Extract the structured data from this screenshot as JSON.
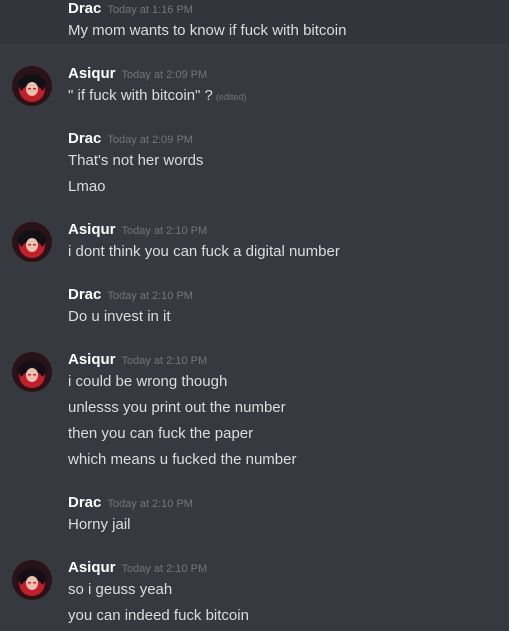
{
  "messages": [
    {
      "author": "Drac",
      "time": "Today at 1:16 PM",
      "lines": [
        "My mom wants to know if fuck with bitcoin"
      ]
    },
    {
      "author": "Asiqur",
      "time": "Today at 2:09 PM",
      "lines": [
        "\" if fuck with bitcoin\" ?"
      ],
      "edited": "(edited)"
    },
    {
      "author": "Drac",
      "time": "Today at 2:09 PM",
      "lines": [
        "That's not her words",
        "Lmao"
      ]
    },
    {
      "author": "Asiqur",
      "time": "Today at 2:10 PM",
      "lines": [
        "i dont think you can fuck a digital number"
      ]
    },
    {
      "author": "Drac",
      "time": "Today at 2:10 PM",
      "lines": [
        "Do u invest in it"
      ]
    },
    {
      "author": "Asiqur",
      "time": "Today at 2:10 PM",
      "lines": [
        "i could be wrong though",
        "unlesss you print out the number",
        "then you can fuck the paper",
        "which means u fucked the number"
      ]
    },
    {
      "author": "Drac",
      "time": "Today at 2:10 PM",
      "lines": [
        "Horny jail"
      ]
    },
    {
      "author": "Asiqur",
      "time": "Today at 2:10 PM",
      "lines": [
        "so i geuss yeah",
        "you can indeed fuck bitcoin"
      ]
    }
  ],
  "avatar_icon": "user-avatar-icon",
  "colors": {
    "background": "#36393f",
    "username": "#ffffff",
    "message_text": "#dcddde",
    "timestamp": "#72767d"
  }
}
